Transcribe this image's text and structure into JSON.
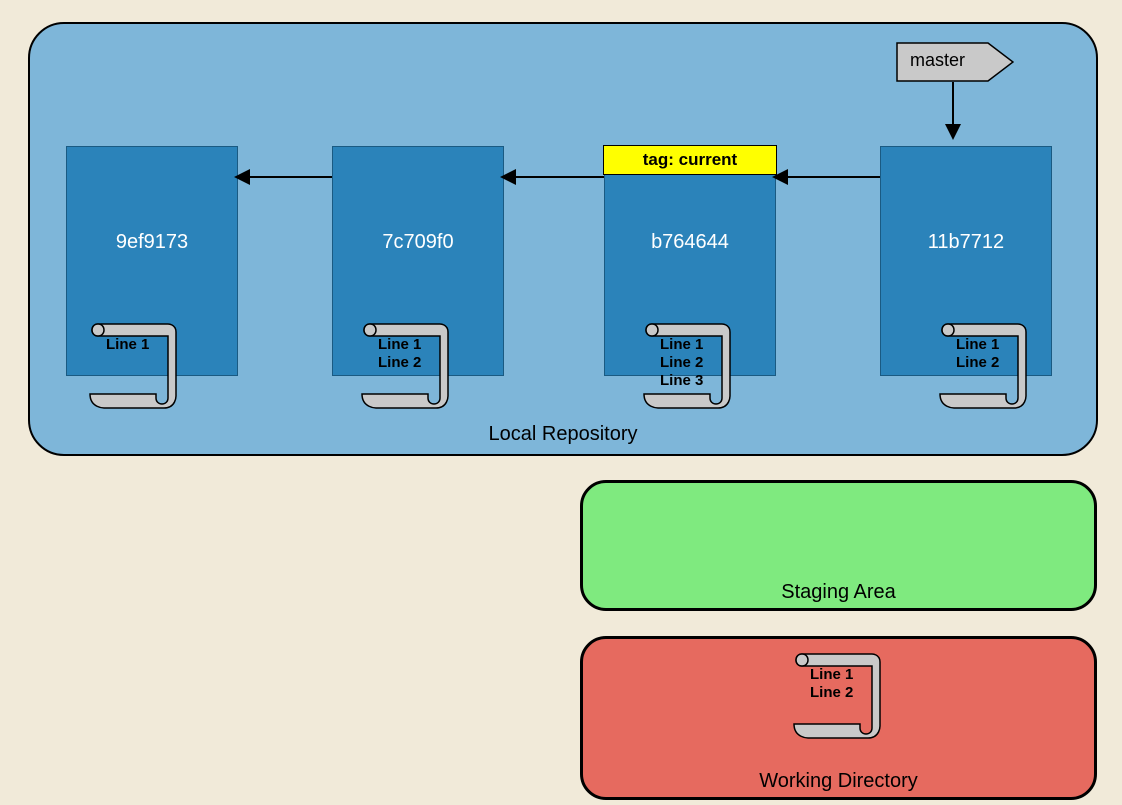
{
  "local_repo": {
    "label": "Local Repository",
    "branch": {
      "name": "master"
    },
    "commits": [
      {
        "hash": "9ef9173",
        "tag": null,
        "file": "Line 1"
      },
      {
        "hash": "7c709f0",
        "tag": null,
        "file": "Line 1\nLine 2"
      },
      {
        "hash": "b764644",
        "tag": "tag: current",
        "file": "Line 1\nLine 2\nLine 3"
      },
      {
        "hash": "11b7712",
        "tag": null,
        "file": "Line 1\nLine 2"
      }
    ]
  },
  "staging_area": {
    "label": "Staging Area"
  },
  "working_directory": {
    "label": "Working Directory",
    "file": "Line 1\nLine 2"
  }
}
